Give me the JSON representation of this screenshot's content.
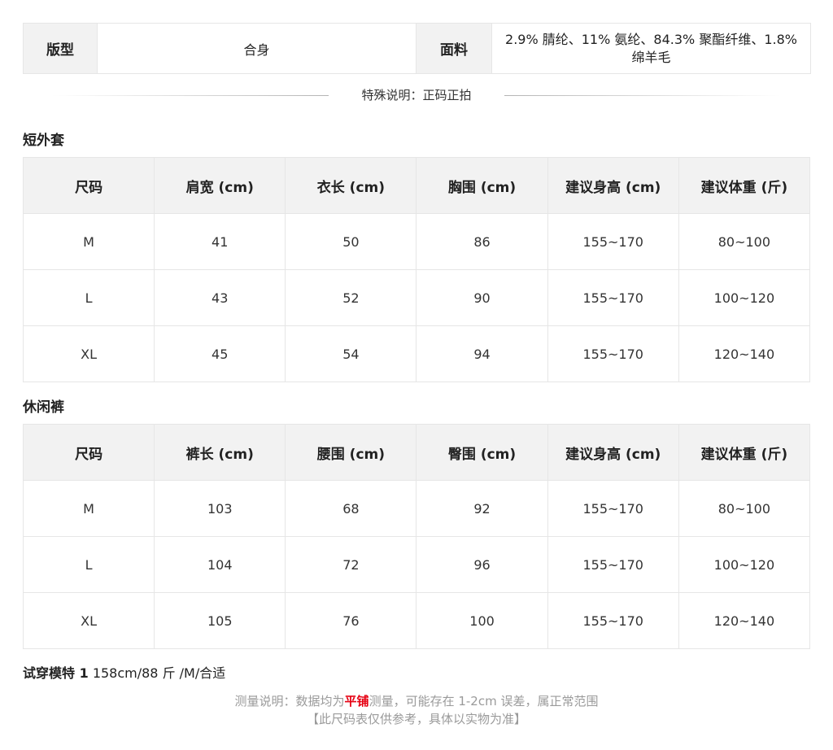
{
  "info": {
    "fit_label": "版型",
    "fit_value": "合身",
    "fabric_label": "面料",
    "fabric_value": "2.9% 腈纶、11% 氨纶、84.3% 聚酯纤维、1.8% 绵羊毛"
  },
  "special_note": "特殊说明：正码正拍",
  "jacket": {
    "title": "短外套",
    "headers": [
      "尺码",
      "肩宽 (cm)",
      "衣长 (cm)",
      "胸围 (cm)",
      "建议身高 (cm)",
      "建议体重 (斤)"
    ],
    "rows": [
      [
        "M",
        "41",
        "50",
        "86",
        "155~170",
        "80~100"
      ],
      [
        "L",
        "43",
        "52",
        "90",
        "155~170",
        "100~120"
      ],
      [
        "XL",
        "45",
        "54",
        "94",
        "155~170",
        "120~140"
      ]
    ]
  },
  "pants": {
    "title": "休闲裤",
    "headers": [
      "尺码",
      "裤长 (cm)",
      "腰围 (cm)",
      "臀围 (cm)",
      "建议身高 (cm)",
      "建议体重 (斤)"
    ],
    "rows": [
      [
        "M",
        "103",
        "68",
        "92",
        "155~170",
        "80~100"
      ],
      [
        "L",
        "104",
        "72",
        "96",
        "155~170",
        "100~120"
      ],
      [
        "XL",
        "105",
        "76",
        "100",
        "155~170",
        "120~140"
      ]
    ]
  },
  "model": {
    "label": "试穿模特 1",
    "value": "158cm/88 斤 /M/合适"
  },
  "footer": {
    "line1_prefix": "测量说明：数据均为",
    "line1_highlight": "平铺",
    "line1_suffix": "测量，可能存在 1-2cm 误差，属正常范围",
    "line2": "【此尺码表仅供参考，具体以实物为准】"
  },
  "colors": {
    "highlight": "#e60012",
    "header_bg": "#f2f2f2",
    "border": "#e6e6e6"
  }
}
